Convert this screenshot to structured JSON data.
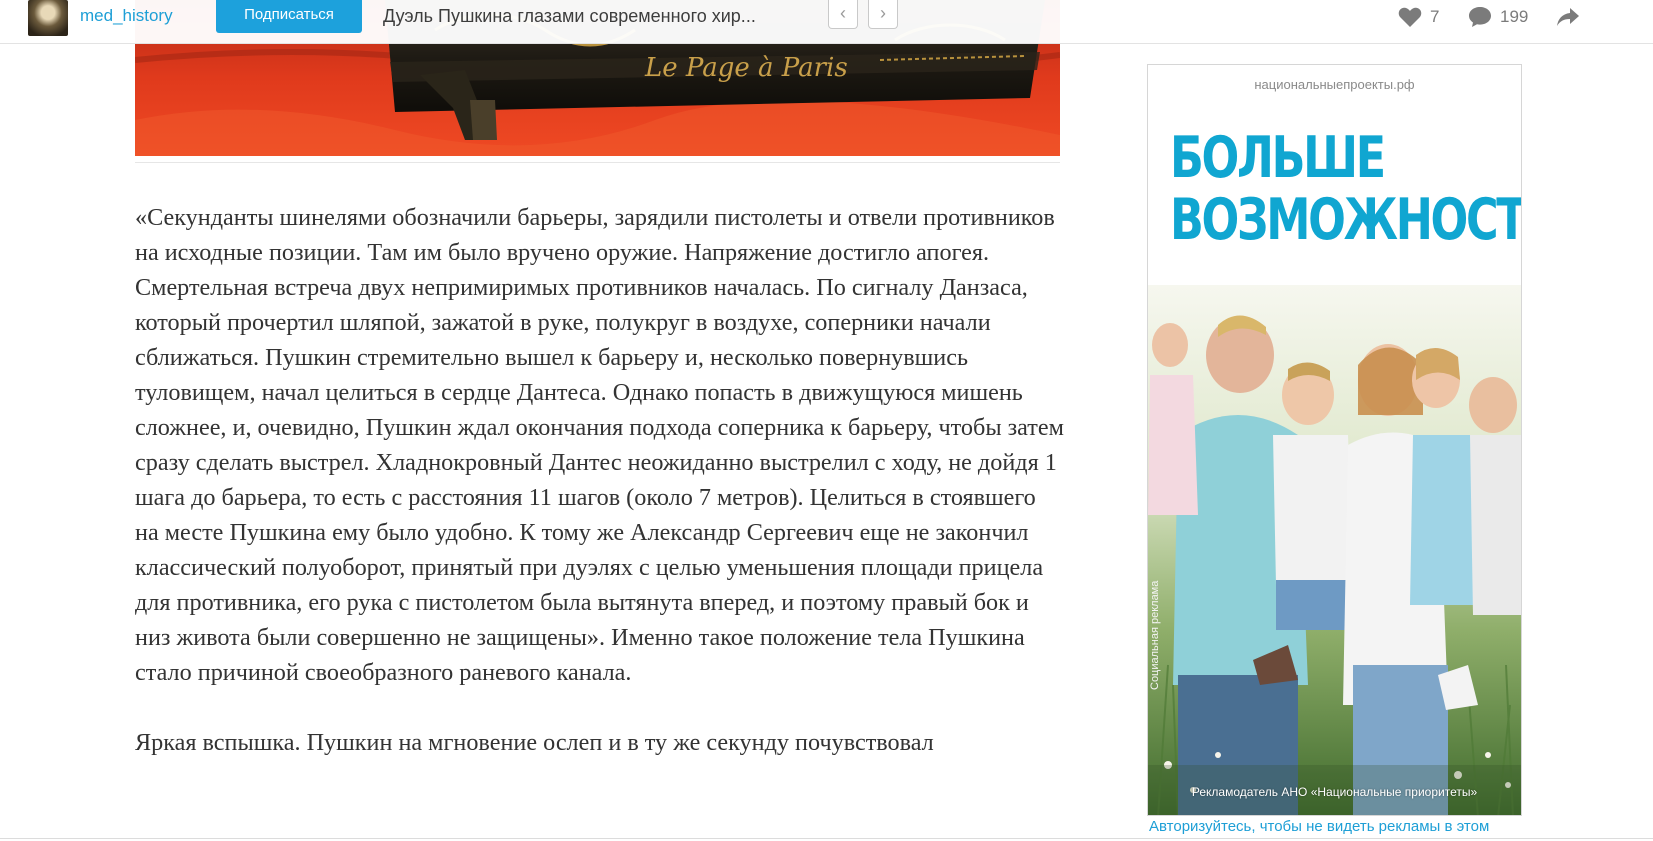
{
  "topbar": {
    "blog_name": "med_history",
    "subscribe_label": "Подписаться",
    "post_title": "Дуэль Пушкина глазами современного хир...",
    "prev_icon": "chevron-left-icon",
    "next_icon": "chevron-right-icon",
    "likes_count": "7",
    "comments_count": "199",
    "like_icon": "heart-icon",
    "comment_icon": "speech-bubble-icon",
    "share_icon": "share-arrow-icon"
  },
  "article": {
    "image_inscription": "Le Page à Paris",
    "paragraphs": [
      "«Секунданты шинелями обозначили барьеры, зарядили пистолеты и отвели противников на исходные позиции. Там им было вручено оружие. Напряжение достигло апогея. Смертельная встреча двух непримиримых противников началась. По сигналу Данзаса, который прочертил шляпой, зажатой в руке, полукруг в воздухе, соперники начали сближаться. Пушкин стремительно вышел к барьеру и, несколько повернувшись туловищем, начал целиться в сердце Дантеса. Однако попасть в движущуюся мишень сложнее, и, очевидно, Пушкин ждал окончания подхода соперника к барьеру, чтобы затем сразу сделать выстрел. Хладнокровный Дантес неожиданно выстрелил с ходу, не дойдя 1 шага до барьера, то есть с расстояния 11 шагов (около 7 метров). Целиться в стоявшего на месте Пушкина ему было удобно. К тому же Александр Сергеевич еще не закончил классический полуоборот, принятый при дуэлях с целью уменьшения площади прицела для противника, его рука с пистолетом была вытянута вперед, и поэтому правый бок и низ живота были совершенно не защищены». Именно такое положение тела Пушкина стало причиной своеобразного раневого канала.",
      "Яркая вспышка. Пушкин на мгновение ослеп и в ту же секунду почувствовал"
    ]
  },
  "ad": {
    "domain": "национальныепроекты.рф",
    "headline_line1": "БОЛЬШЕ",
    "headline_line2": "ВОЗМОЖНОСТЕЙ",
    "side_label": "Социальная реклама",
    "advertiser": "Рекламодатель АНО «Национальные приоритеты»",
    "login_link": "Авторизуйтесь, чтобы не видеть рекламы в этом",
    "accent_color": "#10a6d1"
  },
  "colors": {
    "link_blue": "#1e9fd6",
    "button_blue": "#1da1dc",
    "text_dark": "#333333",
    "icon_gray": "#7b7b7b"
  }
}
